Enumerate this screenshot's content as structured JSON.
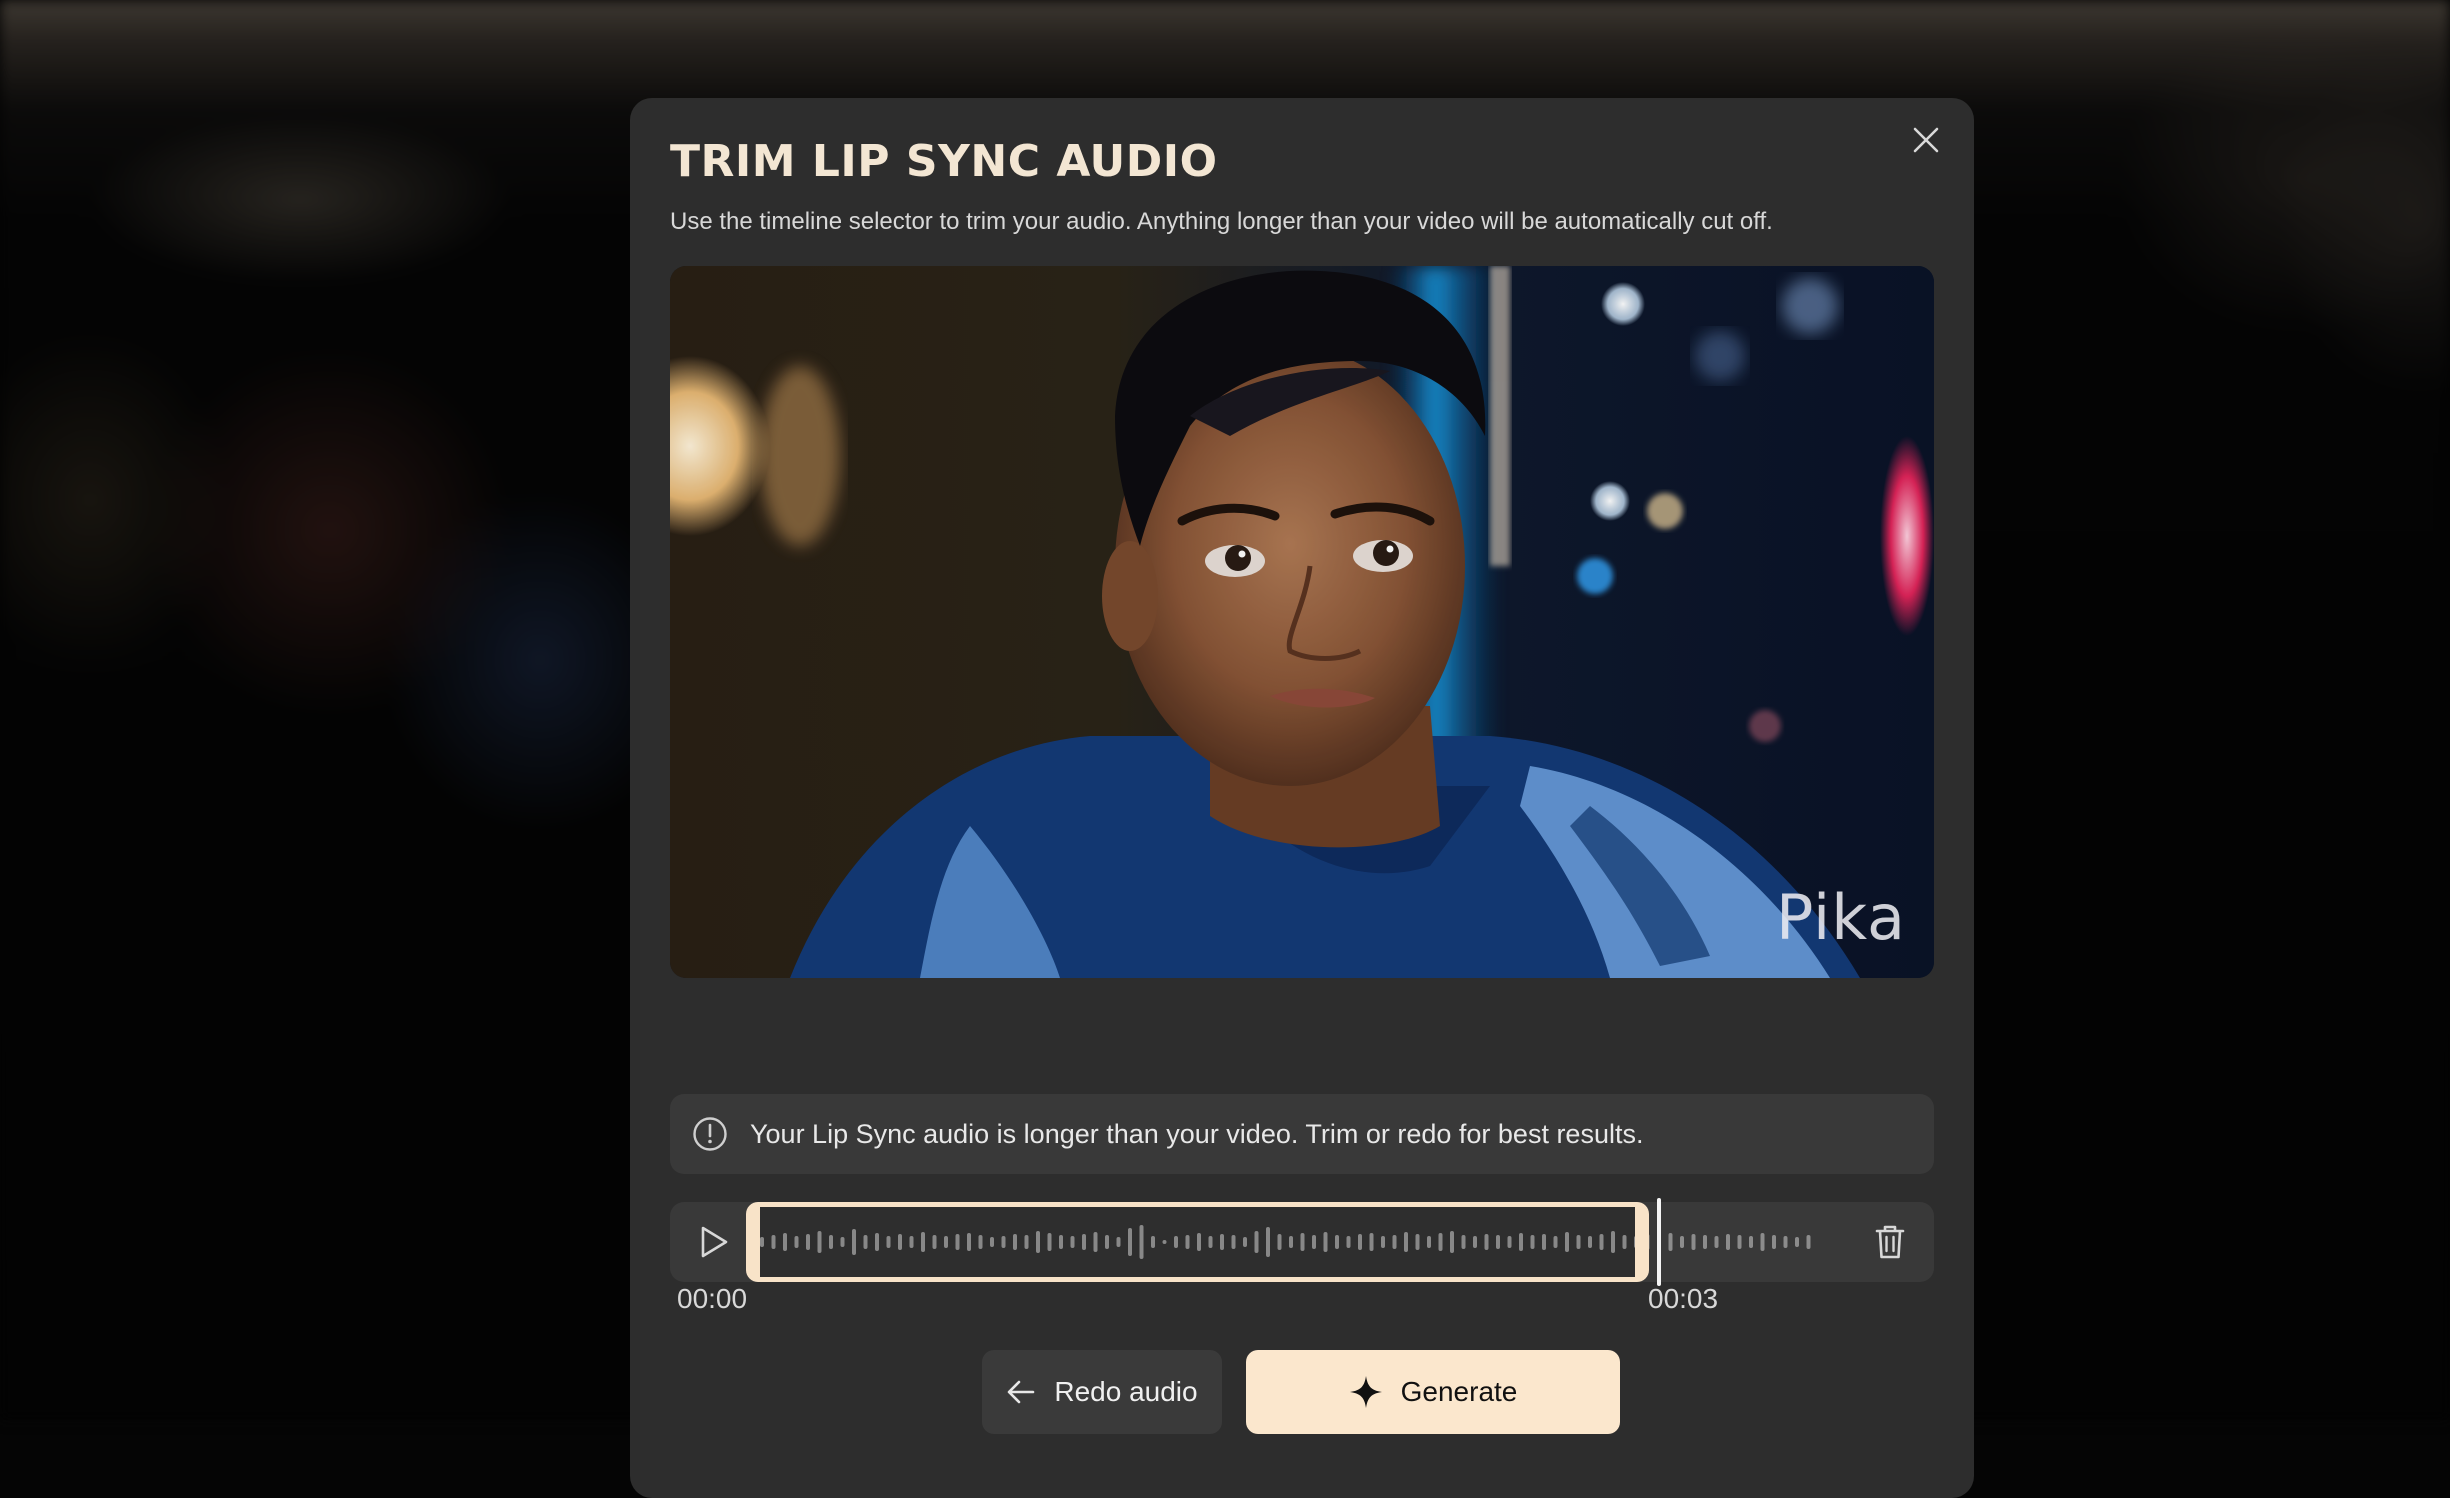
{
  "modal": {
    "title": "TRIM LIP SYNC AUDIO",
    "subtitle": "Use the timeline selector to trim your audio. Anything longer than your video will be automatically cut off.",
    "close_icon": "close-icon"
  },
  "video": {
    "watermark": "Pika"
  },
  "warning": {
    "icon": "alert-circle-icon",
    "text": "Your Lip Sync audio is longer than your video. Trim or redo for best results."
  },
  "timeline": {
    "play_icon": "play-icon",
    "delete_icon": "trash-icon",
    "start_time": "00:00",
    "end_time": "00:03"
  },
  "actions": {
    "redo_label": "Redo audio",
    "redo_icon": "arrow-left-icon",
    "generate_label": "Generate",
    "generate_icon": "sparkle-icon"
  },
  "colors": {
    "accent": "#fbe7cd",
    "title": "#f3e6d3",
    "modal_bg": "#2d2d2d"
  }
}
